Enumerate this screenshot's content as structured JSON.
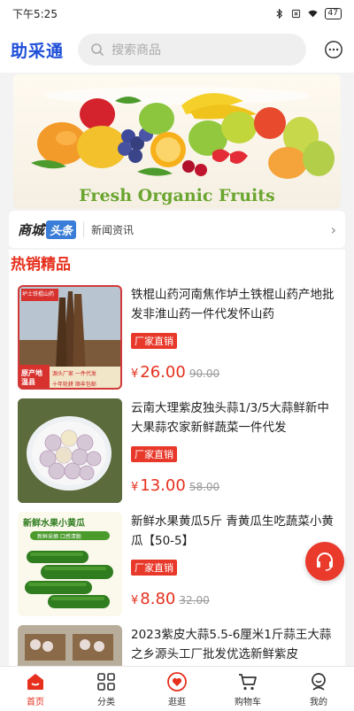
{
  "status_bar": {
    "time": "下午5:25",
    "battery": "47"
  },
  "header": {
    "logo": "助采通",
    "search_placeholder": "搜索商品"
  },
  "banner": {
    "caption": "Fresh Organic Fruits"
  },
  "news": {
    "logo_part1": "商城",
    "logo_part2": "头条",
    "text": "新闻资讯",
    "arrow": "›"
  },
  "hot": {
    "title": "热销精品",
    "currency": "¥",
    "products": [
      {
        "title": "铁棍山药河南焦作垆土铁棍山药产地批发非淮山药一件代发怀山药",
        "tag": "厂家直销",
        "price": "26.00",
        "orig_price": "90.00"
      },
      {
        "title": "云南大理紫皮独头蒜1/3/5大蒜鲜新中大果蒜农家新鲜蔬菜一件代发",
        "tag": "厂家直销",
        "price": "13.00",
        "orig_price": "58.00"
      },
      {
        "title": "新鲜水果黄瓜5斤 青黄瓜生吃蔬菜小黄瓜【50-5】",
        "tag": "厂家直销",
        "price": "8.80",
        "orig_price": "32.00"
      },
      {
        "title": "2023紫皮大蒜5.5-6厘米1斤蒜王大蒜之乡源头工厂批发优选新鲜紫皮",
        "tag": "",
        "price": "",
        "orig_price": ""
      }
    ],
    "img1": {
      "badge_top": "垆土铁棍山药",
      "badge_left": "原产地温县",
      "badge_right": "源头厂家 一件代发",
      "badge_bottom": "十年轮耕 顺丰包邮"
    },
    "img3": {
      "heading": "新鲜水果小黄瓜",
      "sub": "新鲜采摘 口感清脆"
    }
  },
  "tabs": [
    {
      "label": "首页",
      "icon": "home-icon"
    },
    {
      "label": "分类",
      "icon": "grid-icon"
    },
    {
      "label": "逛逛",
      "icon": "heart-badge-icon"
    },
    {
      "label": "购物车",
      "icon": "cart-icon"
    },
    {
      "label": "我的",
      "icon": "user-icon"
    }
  ],
  "colors": {
    "accent": "#e6301d",
    "brand_blue": "#1f4fd8",
    "tag_red": "#e8382a"
  }
}
